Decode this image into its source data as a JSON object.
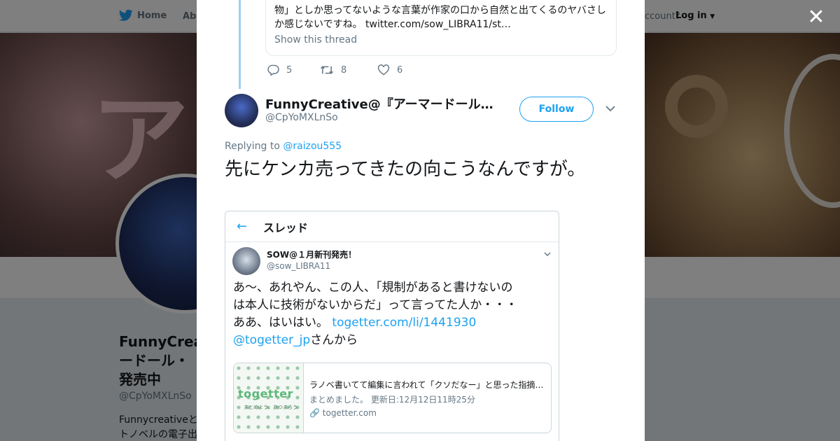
{
  "background": {
    "nav": {
      "home": "Home",
      "about": "Abo",
      "account_prompt": "ccount?",
      "login": "Log in"
    },
    "banner_text": "ア",
    "profile": {
      "name": "FunnyCrea ードール・ 発売中",
      "handle": "@CpYoMXLnSo",
      "bio": "Funnycreativeと トノベルの電子出"
    }
  },
  "modal": {
    "previous_tweet": {
      "text": "物」としか思ってないような言葉が作家の口から自然と出てくるのヤバさしか感じないですね。",
      "link": "twitter.com/sow_LIBRA11/st…",
      "show_thread": "Show this thread",
      "replies": "5",
      "retweets": "8",
      "likes": "6"
    },
    "tweet": {
      "author_name": "FunnyCreative@『アーマードール…",
      "author_handle": "@CpYoMXLnSo",
      "follow_label": "Follow",
      "replying_prefix": "Replying to",
      "replying_to": "@raizou555",
      "text": "先にケンカ売ってきたの向こうなんですが。"
    },
    "embedded": {
      "header_title": "スレッド",
      "name": "SOW@１月新刊発売！",
      "handle": "@sow_LIBRA11",
      "text_line1": "あ〜、あれやん、この人、「規制があると書けないの",
      "text_line2": "は本人に技術がないからだ」って言ってた人か・・・",
      "text_line3_prefix": "ああ、はいはい。",
      "text_link": "togetter.com/li/1441930",
      "text_mention": "@togetter_jp",
      "text_suffix": "さんから",
      "card": {
        "logo": "togetter",
        "logo_tag": "まとめよう、あつまろう",
        "title": "ラノベ書いてて編集に言われて「クソだなー」と思った指摘…",
        "desc_prefix": "まとめました。",
        "updated": "更新日:12月12日11時25分",
        "domain": "togetter.com"
      }
    }
  },
  "colors": {
    "accent": "#1da1f2",
    "thread_line": "#9ad0f5",
    "text_primary": "#14171a",
    "text_secondary": "#657786"
  },
  "icons": [
    "twitter-bird-icon",
    "close-icon",
    "reply-icon",
    "retweet-icon",
    "like-icon",
    "chevron-down-icon",
    "back-arrow-icon",
    "link-icon"
  ]
}
